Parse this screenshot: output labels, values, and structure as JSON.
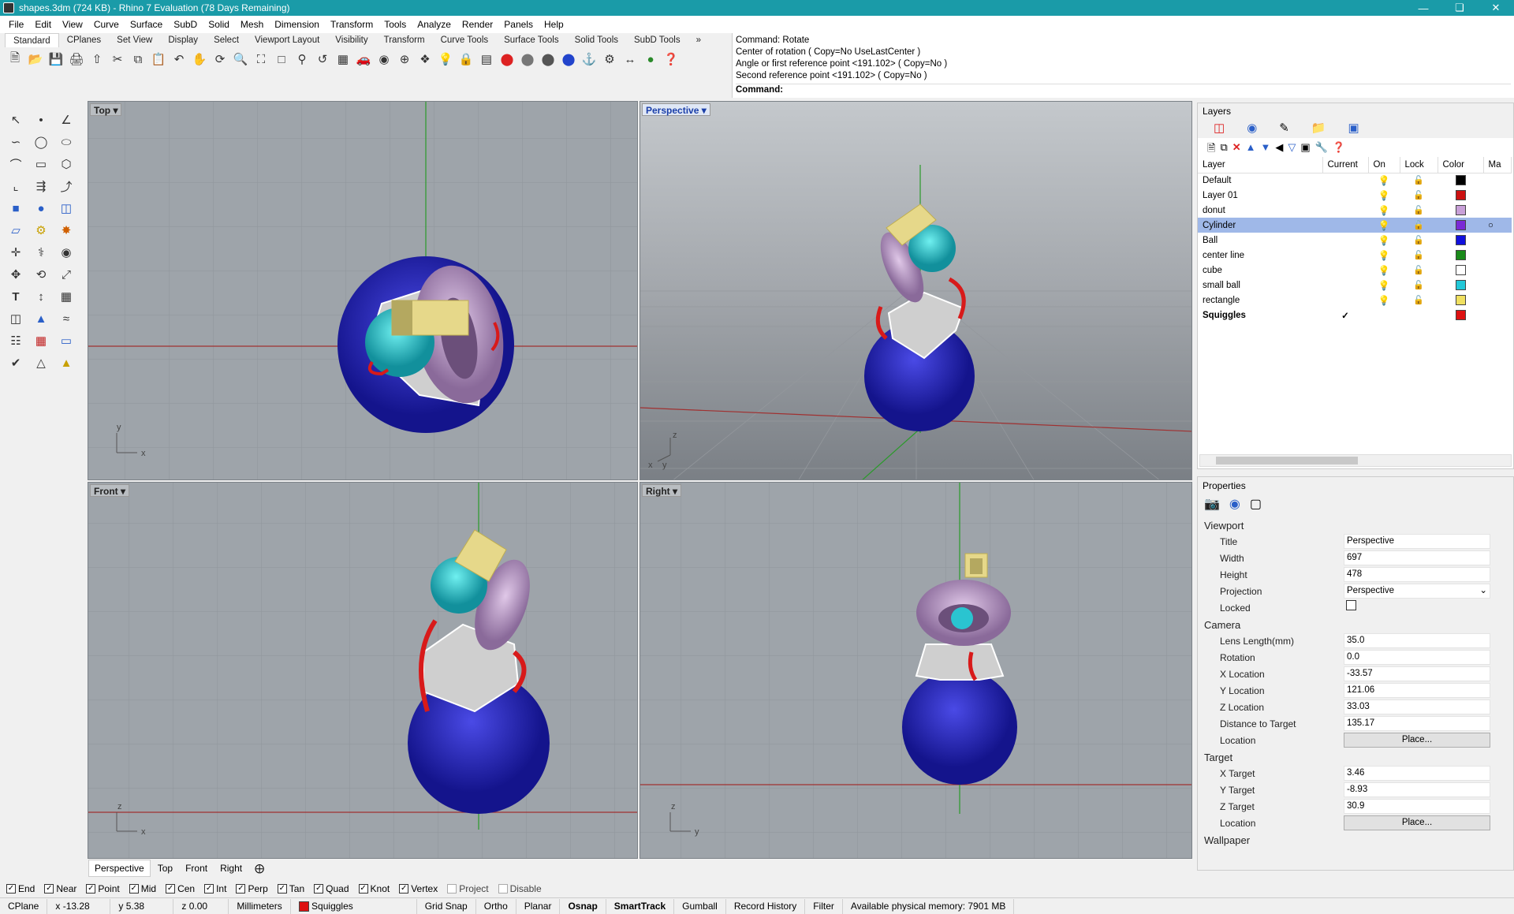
{
  "window": {
    "title": "shapes.3dm (724 KB) - Rhino 7 Evaluation (78 Days Remaining)"
  },
  "menu": [
    "File",
    "Edit",
    "View",
    "Curve",
    "Surface",
    "SubD",
    "Solid",
    "Mesh",
    "Dimension",
    "Transform",
    "Tools",
    "Analyze",
    "Render",
    "Panels",
    "Help"
  ],
  "toolbar_tabs": [
    "Standard",
    "CPlanes",
    "Set View",
    "Display",
    "Select",
    "Viewport Layout",
    "Visibility",
    "Transform",
    "Curve Tools",
    "Surface Tools",
    "Solid Tools",
    "SubD Tools"
  ],
  "command": {
    "history": [
      "Command: Rotate",
      "Center of rotation ( Copy=No  UseLastCenter )",
      "Angle or first reference point <191.102> ( Copy=No )",
      "Second reference point <191.102> ( Copy=No )"
    ],
    "prompt": "Command:"
  },
  "viewports": {
    "top": "Top",
    "perspective": "Perspective",
    "front": "Front",
    "right": "Right"
  },
  "viewport_tabs": [
    "Perspective",
    "Top",
    "Front",
    "Right"
  ],
  "layers": {
    "panel_title": "Layers",
    "headers": {
      "layer": "Layer",
      "current": "Current",
      "on": "On",
      "lock": "Lock",
      "color": "Color",
      "material": "Ma"
    },
    "rows": [
      {
        "name": "Default",
        "color": "#000000"
      },
      {
        "name": "Layer 01",
        "color": "#cc1111"
      },
      {
        "name": "donut",
        "color": "#c8a0d8"
      },
      {
        "name": "Cylinder",
        "color": "#7a2ad6",
        "selected": true
      },
      {
        "name": "Ball",
        "color": "#1010dd"
      },
      {
        "name": "center line",
        "color": "#1a8a1a"
      },
      {
        "name": "cube",
        "color": "#ffffff"
      },
      {
        "name": "small ball",
        "color": "#22c8d8"
      },
      {
        "name": "rectangle",
        "color": "#f0e060"
      },
      {
        "name": "Squiggles",
        "color": "#dd1111",
        "current": true
      }
    ],
    "current_mark": "✓"
  },
  "properties": {
    "panel_title": "Properties",
    "viewport_section": "Viewport",
    "viewport": [
      {
        "k": "Title",
        "v": "Perspective"
      },
      {
        "k": "Width",
        "v": "697"
      },
      {
        "k": "Height",
        "v": "478"
      },
      {
        "k": "Projection",
        "v": "Perspective"
      },
      {
        "k": "Locked",
        "v": ""
      }
    ],
    "camera_section": "Camera",
    "camera": [
      {
        "k": "Lens Length(mm)",
        "v": "35.0"
      },
      {
        "k": "Rotation",
        "v": "0.0"
      },
      {
        "k": "X Location",
        "v": "-33.57"
      },
      {
        "k": "Y Location",
        "v": "121.06"
      },
      {
        "k": "Z Location",
        "v": "33.03"
      },
      {
        "k": "Distance to Target",
        "v": "135.17"
      },
      {
        "k": "Location",
        "v": "Place..."
      }
    ],
    "target_section": "Target",
    "target": [
      {
        "k": "X Target",
        "v": "3.46"
      },
      {
        "k": "Y Target",
        "v": "-8.93"
      },
      {
        "k": "Z Target",
        "v": "30.9"
      },
      {
        "k": "Location",
        "v": "Place..."
      }
    ],
    "wallpaper_section": "Wallpaper"
  },
  "osnaps": [
    {
      "label": "End",
      "on": true
    },
    {
      "label": "Near",
      "on": true
    },
    {
      "label": "Point",
      "on": true
    },
    {
      "label": "Mid",
      "on": true
    },
    {
      "label": "Cen",
      "on": true
    },
    {
      "label": "Int",
      "on": true
    },
    {
      "label": "Perp",
      "on": true
    },
    {
      "label": "Tan",
      "on": true
    },
    {
      "label": "Quad",
      "on": true
    },
    {
      "label": "Knot",
      "on": true
    },
    {
      "label": "Vertex",
      "on": true
    },
    {
      "label": "Project",
      "on": false
    },
    {
      "label": "Disable",
      "on": false
    }
  ],
  "status": {
    "cplane": "CPlane",
    "x": "x -13.28",
    "y": "y 5.38",
    "z": "z 0.00",
    "units": "Millimeters",
    "layer": "Squiggles",
    "layer_color": "#dd1111",
    "toggles": [
      {
        "label": "Grid Snap",
        "bold": false
      },
      {
        "label": "Ortho",
        "bold": false
      },
      {
        "label": "Planar",
        "bold": false
      },
      {
        "label": "Osnap",
        "bold": true
      },
      {
        "label": "SmartTrack",
        "bold": true
      },
      {
        "label": "Gumball",
        "bold": false
      },
      {
        "label": "Record History",
        "bold": false
      },
      {
        "label": "Filter",
        "bold": false
      }
    ],
    "memory": "Available physical memory: 7901 MB"
  },
  "axes": {
    "x": "x",
    "y": "y",
    "z": "z"
  }
}
